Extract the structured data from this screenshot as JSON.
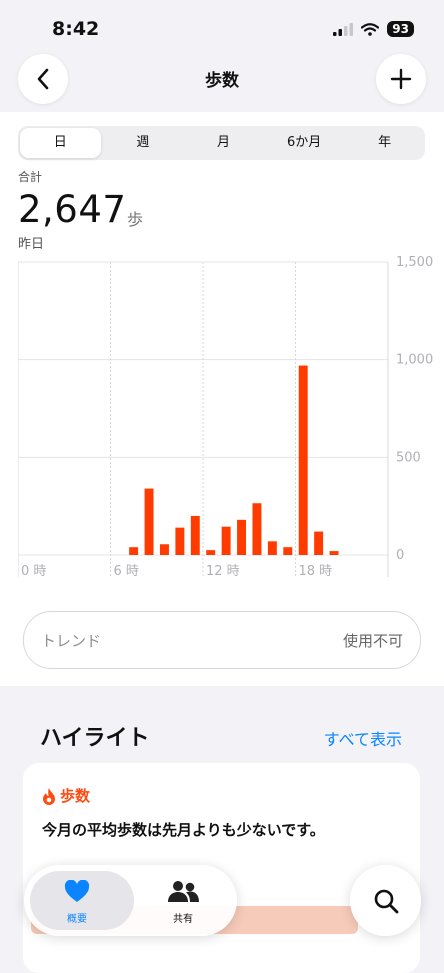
{
  "status_bar": {
    "time": "8:42",
    "battery": "93"
  },
  "nav": {
    "title": "歩数"
  },
  "segments": [
    {
      "label": "日",
      "active": true
    },
    {
      "label": "週",
      "active": false
    },
    {
      "label": "月",
      "active": false
    },
    {
      "label": "6か月",
      "active": false
    },
    {
      "label": "年",
      "active": false
    }
  ],
  "summary": {
    "label": "合計",
    "value": "2,647",
    "unit": "歩",
    "date": "昨日"
  },
  "chart_data": {
    "type": "bar",
    "x_tick_labels": [
      "0 時",
      "6 時",
      "12 時",
      "18 時"
    ],
    "y_tick_labels": [
      "1,500",
      "1,000",
      "500",
      "0"
    ],
    "hours": [
      7,
      8,
      9,
      10,
      11,
      12,
      13,
      14,
      15,
      16,
      17,
      18,
      19,
      20
    ],
    "values": [
      40,
      340,
      55,
      140,
      200,
      25,
      145,
      180,
      265,
      70,
      40,
      970,
      120,
      20
    ],
    "ylim": [
      0,
      1500
    ],
    "xlim": [
      0,
      24
    ],
    "color": "#ff3b00"
  },
  "trend": {
    "label": "トレンド",
    "status": "使用不可"
  },
  "highlights": {
    "title": "ハイライト",
    "show_all": "すべて表示",
    "card": {
      "category": "歩数",
      "text": "今月の平均歩数は先月よりも少ないです。"
    }
  },
  "tab_bar": {
    "items": [
      {
        "label": "概要",
        "icon": "heart-icon",
        "active": true
      },
      {
        "label": "共有",
        "icon": "people-icon",
        "active": false
      }
    ]
  },
  "colors": {
    "accent": "#0a84ff",
    "bar": "#ff3b00",
    "highlight": "#ff4b12"
  }
}
